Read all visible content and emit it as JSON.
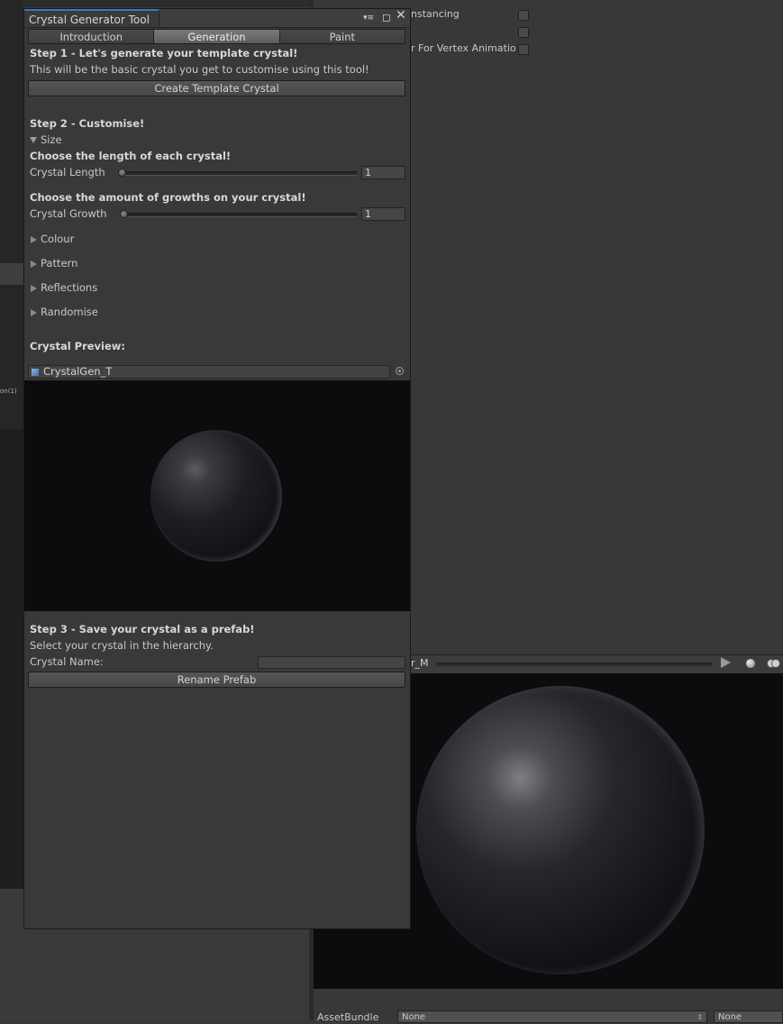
{
  "window": {
    "title": "Crystal Generator Tool",
    "tabs": [
      {
        "label": "Introduction",
        "active": false
      },
      {
        "label": "Generation",
        "active": true
      },
      {
        "label": "Paint",
        "active": false
      }
    ]
  },
  "step1": {
    "heading": "Step 1 - Let's generate your template crystal!",
    "description": "This will be the basic crystal you get to customise using this tool!",
    "button": "Create Template Crystal"
  },
  "step2": {
    "heading": "Step 2 - Customise!",
    "size_foldout": "Size",
    "length_prompt": "Choose the length of each crystal!",
    "length_label": "Crystal Length",
    "length_value": "1",
    "growth_prompt": "Choose the amount of growths on your crystal!",
    "growth_label": "Crystal Growth",
    "growth_value": "1",
    "foldouts": [
      "Colour",
      "Pattern",
      "Reflections",
      "Randomise"
    ]
  },
  "preview": {
    "heading": "Crystal Preview:",
    "object": "CrystalGen_T"
  },
  "step3": {
    "heading": "Step 3 - Save your crystal as a prefab!",
    "description": "Select your crystal in the hierarchy.",
    "name_label": "Crystal Name:",
    "name_value": "",
    "button": "Rename Prefab"
  },
  "background": {
    "left_label": "on(1)",
    "inspector_rows": [
      "nstancing",
      "",
      "r For Vertex Animatio"
    ],
    "preview_name": "r_M",
    "assetbundle_label": "AssetBundle",
    "assetbundle_value": "None",
    "assetbundle_variant": "None"
  },
  "colors": {
    "accent": "#3f76c0",
    "panel": "#393939",
    "preview_bg": "#0b0c0e"
  }
}
